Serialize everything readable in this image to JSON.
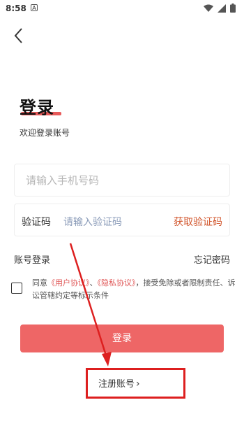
{
  "status_bar": {
    "time": "8:58",
    "notif_glyph": "A"
  },
  "header": {
    "back_icon": "chevron-left-icon"
  },
  "login": {
    "title": "登录",
    "subtitle": "欢迎登录账号",
    "phone_placeholder": "请输入手机号码",
    "code_label": "验证码",
    "code_placeholder": "请输入验证码",
    "get_code": "获取验证码",
    "account_login": "账号登录",
    "forgot_password": "忘记密码",
    "agree_prefix": "同意",
    "user_agreement": "《用户协议》",
    "separator": "、",
    "privacy_agreement": "《隐私协议》",
    "agree_suffix": "，接受免除或者限制责任、诉讼管辖约定等标示条件",
    "login_button": "登录",
    "register": "注册账号"
  },
  "colors": {
    "accent": "#ee6666",
    "link": "#e05a5a",
    "get_code": "#d2572e",
    "annotation": "#dd1f1f"
  }
}
